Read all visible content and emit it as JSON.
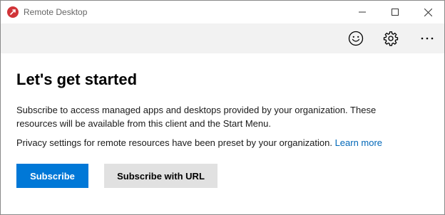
{
  "window": {
    "title": "Remote Desktop"
  },
  "toolbar": {
    "feedback_icon": "smiley-icon",
    "settings_icon": "gear-icon",
    "more_icon": "more-options-icon"
  },
  "main": {
    "heading": "Let's get started",
    "description": "Subscribe to access managed apps and desktops provided by your organization. These resources will be available from this client and the Start Menu.",
    "privacy_text": "Privacy settings for remote resources have been preset by your organization. ",
    "learn_more_label": "Learn more",
    "subscribe_label": "Subscribe",
    "subscribe_url_label": "Subscribe with URL"
  },
  "colors": {
    "accent": "#0078d7",
    "link": "#0067b8",
    "app_icon": "#d13438",
    "toolbar_bg": "#f2f2f2",
    "secondary_button_bg": "#e1e1e1"
  }
}
